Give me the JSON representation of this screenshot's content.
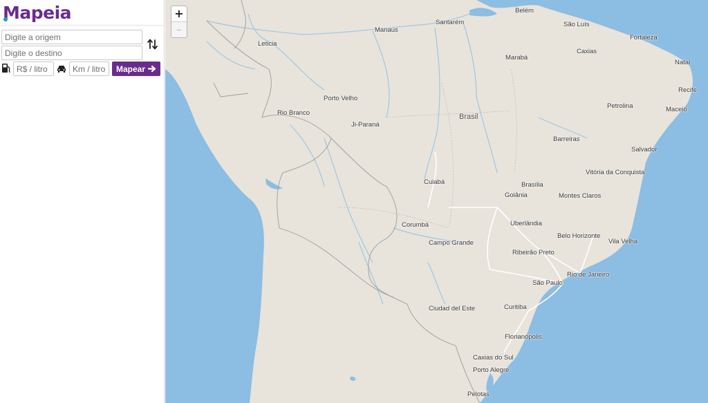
{
  "brand": {
    "name_first": "M",
    "name_rest": "apeia"
  },
  "form": {
    "origin_placeholder": "Digite a origem",
    "destination_placeholder": "Digite o destino",
    "price_placeholder": "R$ / litro",
    "consumption_placeholder": "Km / litro",
    "submit_label": "Mapear"
  },
  "map": {
    "zoom_in_label": "+",
    "zoom_out_label": "–",
    "country_label": "Brasil",
    "cities": {
      "belem": "Belém",
      "santarem": "Santarém",
      "manaus": "Manaus",
      "sao_luis": "São Luís",
      "fortaleza": "Fortaleza",
      "leticia": "Leticia",
      "maraba": "Marabá",
      "caxias": "Caxias",
      "natal": "Natal",
      "recife": "Recife",
      "porto_velho": "Porto Velho",
      "petrolina": "Petrolina",
      "maceio": "Maceió",
      "rio_branco": "Rio Branco",
      "ji_parana": "Ji-Paraná",
      "barreiras": "Barreiras",
      "salvador": "Salvador",
      "vitoria_conquista": "Vitória da Conquista",
      "cuiaba": "Cuiabá",
      "brasilia": "Brasília",
      "goiania": "Goiânia",
      "montes_claros": "Montes Claros",
      "uberlandia": "Uberlândia",
      "corumba": "Corumbá",
      "belo_horizonte": "Belo Horizonte",
      "campo_grande": "Campo Grande",
      "vila_velha": "Vila Velha",
      "ribeirao_preto": "Ribeirão Preto",
      "rio_de_janeiro": "Rio de Janeiro",
      "sao_paulo": "São Paulo",
      "curitiba": "Curitiba",
      "ciudad_del_este": "Ciudad del Este",
      "florianopolis": "Florianópolis",
      "caxias_do_sul": "Caxias do Sul",
      "porto_alegre": "Porto Alegre",
      "pelotas": "Pelotas"
    },
    "colors": {
      "land": "#e8e4db",
      "water": "#8cbde3",
      "river": "#9ec6e5",
      "border": "#9b9b9b"
    }
  }
}
